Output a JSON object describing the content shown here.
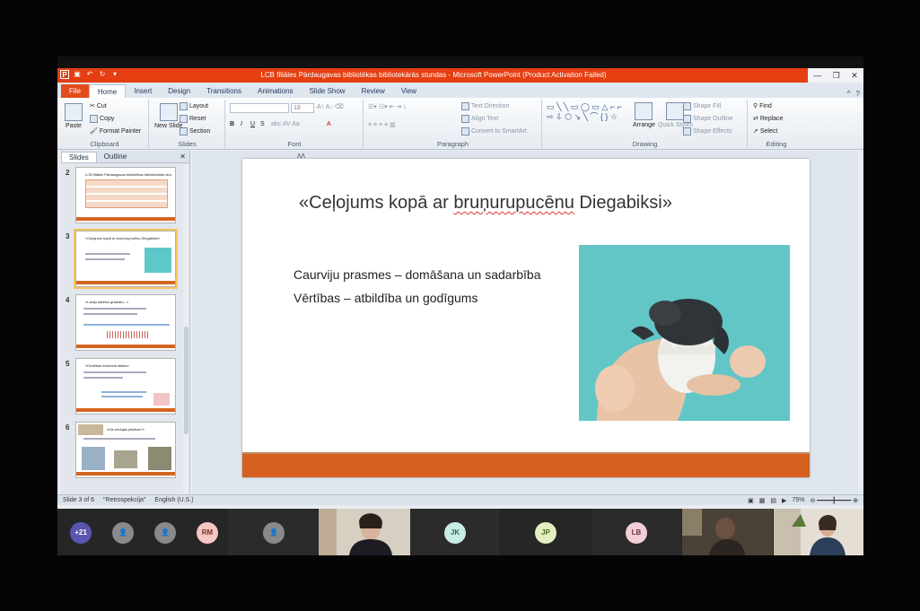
{
  "window": {
    "title": "LCB filiāles Pārdaugavas bibliotēkas bibliotekārās stundas - Microsoft PowerPoint (Product Activation Failed)"
  },
  "tabs": [
    "File",
    "Home",
    "Insert",
    "Design",
    "Transitions",
    "Animations",
    "Slide Show",
    "Review",
    "View"
  ],
  "ribbon": {
    "clipboard": {
      "paste": "Paste",
      "cut": "Cut",
      "copy": "Copy",
      "format_painter": "Format Painter",
      "name": "Clipboard"
    },
    "slides": {
      "new_slide": "New Slide",
      "layout": "Layout",
      "reset": "Reset",
      "section": "Section",
      "name": "Slides"
    },
    "font": {
      "size": "18",
      "name": "Font"
    },
    "paragraph": {
      "text_direction": "Text Direction",
      "align_text": "Align Text",
      "convert": "Convert to SmartArt",
      "name": "Paragraph"
    },
    "drawing": {
      "arrange": "Arrange",
      "quick_styles": "Quick Styles",
      "shape_fill": "Shape Fill",
      "shape_outline": "Shape Outline",
      "shape_effects": "Shape Effects",
      "name": "Drawing"
    },
    "editing": {
      "find": "Find",
      "replace": "Replace",
      "select": "Select",
      "name": "Editing"
    }
  },
  "pane": {
    "tab_slides": "Slides",
    "tab_outline": "Outline",
    "thumbs": [
      {
        "num": "2",
        "title": "LCB filiāles Pārdaugavas bibliotēkas bibliotekārās stundas"
      },
      {
        "num": "3",
        "title": "«Ceļojums kopā ar bruņurupucēnu Diegabiksi»"
      },
      {
        "num": "4",
        "title": "«Lasīju kādreiz grāmatu...»"
      },
      {
        "num": "5",
        "title": "«Drošības interneta stāsts»"
      },
      {
        "num": "6",
        "title": "«Kā veidojas pilsētas?»"
      }
    ]
  },
  "slide": {
    "title_pre": "«Ceļojums kopā ar ",
    "title_squig": "bruņurupucēnu",
    "title_post": " Diegabiksi»",
    "bullet1": "Caurviju prasmes – domāšana un sadarbība",
    "bullet2": "Vērtības – atbildība un godīgums"
  },
  "status": {
    "slide": "Slide 3 of 6",
    "theme": "\"Retrospekcija\"",
    "language": "English (U.S.)",
    "zoom": "75%"
  },
  "participants": [
    {
      "label": "+21",
      "style": "av-blue"
    },
    {
      "label": "",
      "style": "av-gray"
    },
    {
      "label": "",
      "style": "av-gray"
    },
    {
      "label": "RM",
      "style": "av-pink"
    },
    {
      "label": "",
      "style": "av-gray"
    },
    {
      "label": "JK",
      "style": "av-teal"
    },
    {
      "label": "JP",
      "style": "av-lime"
    },
    {
      "label": "LB",
      "style": "av-rose"
    }
  ]
}
